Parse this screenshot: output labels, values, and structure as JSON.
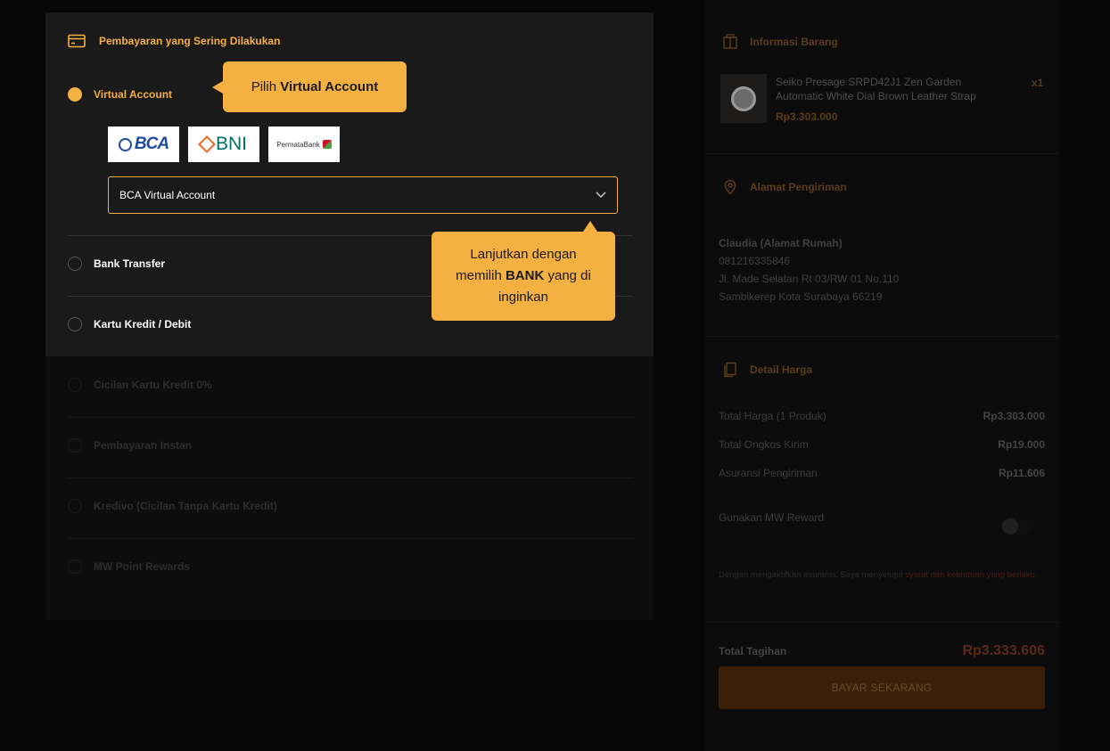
{
  "payment": {
    "header": "Pembayaran yang Sering Dilakukan",
    "options": [
      {
        "label": "Virtual Account",
        "selected": true
      },
      {
        "label": "Bank Transfer",
        "selected": false
      },
      {
        "label": "Kartu Kredit / Debit",
        "selected": false
      },
      {
        "label": "Cicilan Kartu Kredit 0%",
        "selected": false
      },
      {
        "label": "Pembayaran Instan",
        "selected": false
      },
      {
        "label": "Kredivo (Cicilan Tanpa Kartu Kredit)",
        "selected": false
      },
      {
        "label": "MW Point Rewards",
        "selected": false
      }
    ],
    "banks": [
      "BCA",
      "BNI",
      "PermataBank"
    ],
    "selected_bank": "BCA Virtual Account"
  },
  "tooltips": {
    "tip1_prefix": "Pilih ",
    "tip1_bold": "Virtual Account",
    "tip2_line1": "Lanjutkan dengan",
    "tip2_prefix": "memilih ",
    "tip2_bold": "BANK",
    "tip2_suffix": " yang di",
    "tip2_line3": "inginkan"
  },
  "summary": {
    "item_section": "Informasi Barang",
    "product_name": "Seiko Presage SRPD42J1 Zen Garden Automatic White Dial Brown Leather Strap",
    "product_price": "Rp3.303.000",
    "product_qty": "x1",
    "address_section": "Alamat Pengiriman",
    "address": {
      "name": "Claudia (Alamat Rumah)",
      "phone": "081216335846",
      "line1": "Jl. Made Selatan Rt 03/RW 01 No.110",
      "line2": "Sambikerep Kota Surabaya 66219"
    },
    "price_section": "Detail Harga",
    "rows": [
      {
        "label": "Total Harga (1 Produk)",
        "amount": "Rp3.303.000"
      },
      {
        "label": "Total Ongkos Kirim",
        "amount": "Rp19.000"
      },
      {
        "label": "Asuransi Pengiriman",
        "amount": "Rp11.606"
      }
    ],
    "reward_label": "Gunakan MW Reward",
    "terms_prefix": "Dengan mengaktifkan asuransi, Saya menyetujui ",
    "terms_link": "syarat dan ketentuan yang berlaku.",
    "total_label": "Total Tagihan",
    "total_value": "Rp3.333.606",
    "pay_button": "BAYAR SEKARANG"
  },
  "colors": {
    "accent": "#f5b042",
    "panel": "#1a1a1a",
    "background": "#070707"
  }
}
